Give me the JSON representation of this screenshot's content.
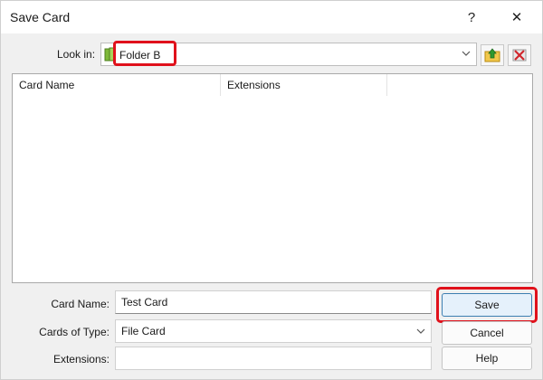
{
  "window": {
    "title": "Save Card",
    "help_glyph": "?",
    "close_glyph": "✕"
  },
  "lookin": {
    "label": "Look in:",
    "value": "Folder B",
    "folder_icon": "folder-icon",
    "up_icon": "up-folder-icon",
    "delete_icon": "delete-icon"
  },
  "list": {
    "columns": [
      "Card Name",
      "Extensions"
    ]
  },
  "form": {
    "card_name_label": "Card Name:",
    "card_name_value": "Test Card",
    "type_label": "Cards of Type:",
    "type_value": "File Card",
    "extensions_label": "Extensions:",
    "extensions_value": ""
  },
  "buttons": {
    "save": "Save",
    "cancel": "Cancel",
    "help": "Help"
  },
  "colors": {
    "highlight": "#e0111b",
    "default_button_bg": "#e5f1fb",
    "default_button_border": "#3c7fb1"
  }
}
